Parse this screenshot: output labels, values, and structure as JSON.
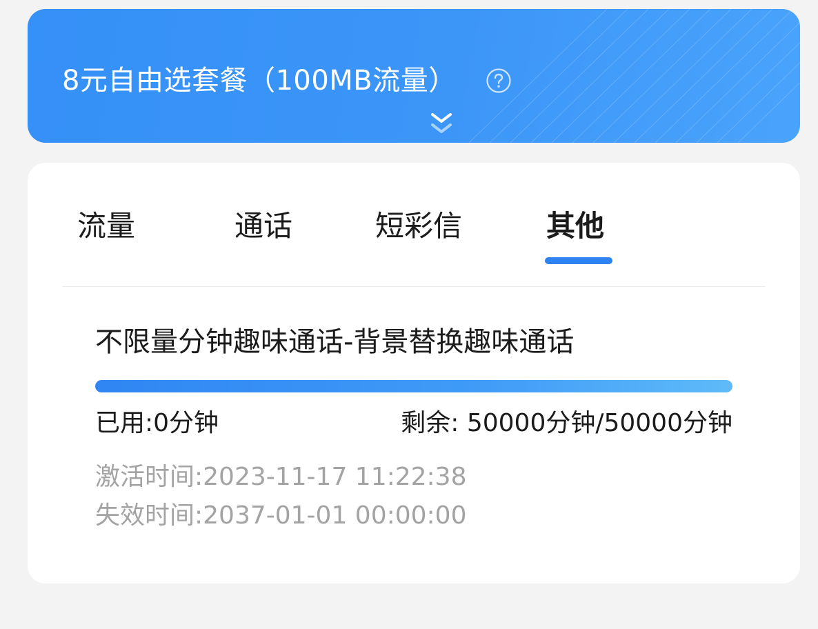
{
  "plan": {
    "title": "8元自由选套餐（100MB流量）",
    "help_icon": "question-circle-icon",
    "expand_icon": "double-chevron-down-icon"
  },
  "tabs": [
    {
      "label": "流量",
      "selected": false
    },
    {
      "label": "通话",
      "selected": false
    },
    {
      "label": "短彩信",
      "selected": false
    },
    {
      "label": "其他",
      "selected": true
    }
  ],
  "usage": {
    "package_name": "不限量分钟趣味通话-背景替换趣味通话",
    "used_label": "已用:0分钟",
    "remaining_label": "剩余: 50000分钟/50000分钟",
    "remaining_fraction": 1.0,
    "activation_time": "激活时间:2023-11-17 11:22:38",
    "expiry_time": "失效时间:2037-01-01 00:00:00"
  },
  "colors": {
    "accent": "#2f82f2",
    "header_bg": "#3a93f8",
    "muted_text": "#a3a3a3"
  }
}
